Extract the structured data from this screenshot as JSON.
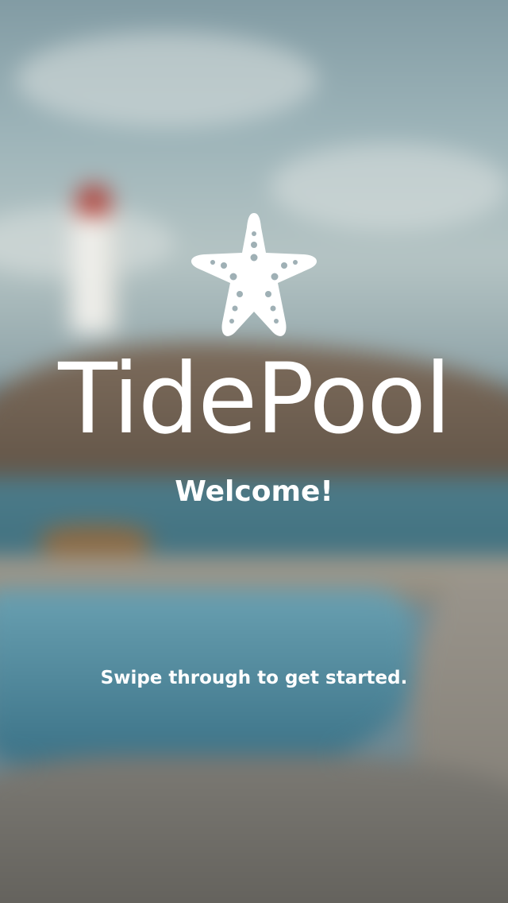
{
  "app": {
    "brand_name": "TidePool",
    "logo_icon": "starfish-icon",
    "text_color": "#ffffff"
  },
  "onboarding": {
    "title": "Welcome!",
    "hint": "Swipe through to get started."
  },
  "background": {
    "description_icon": "lighthouse-tidepool-photo"
  }
}
